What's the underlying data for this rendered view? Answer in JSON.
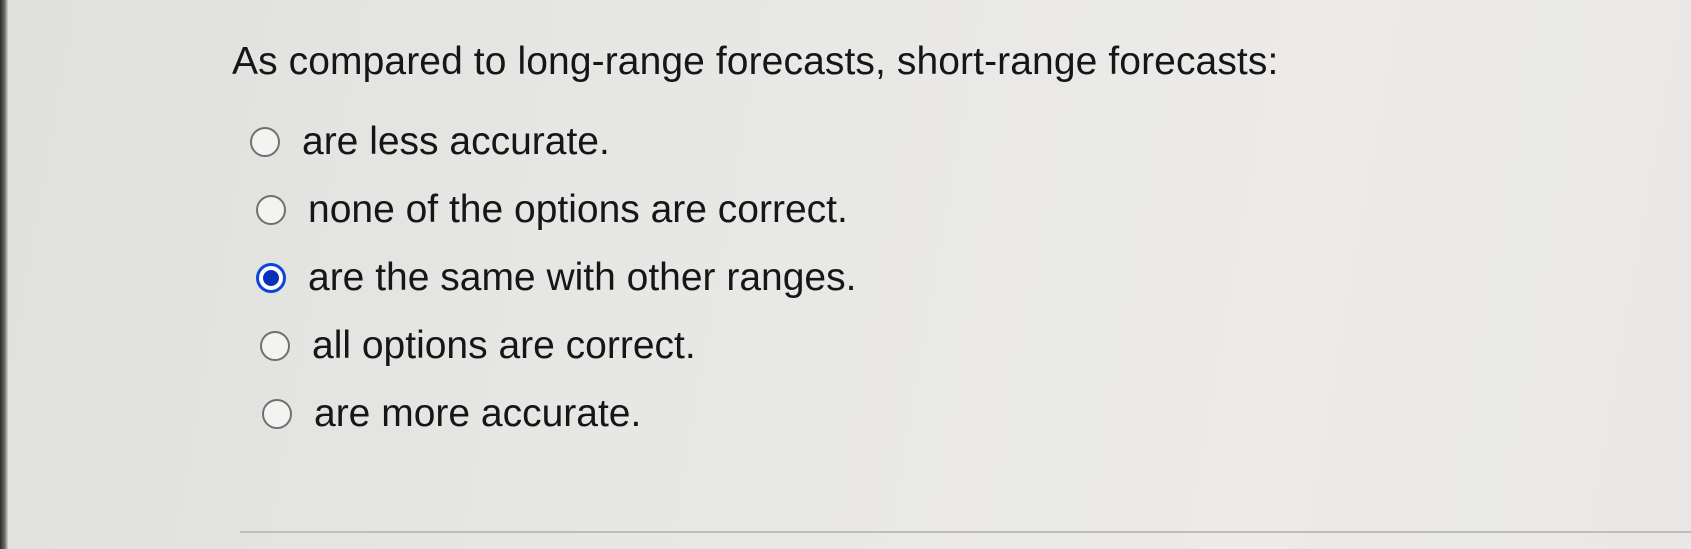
{
  "question": {
    "text": "As compared to long-range forecasts, short-range forecasts:"
  },
  "options": [
    {
      "label": "are less accurate.",
      "selected": false
    },
    {
      "label": "none of the options are correct.",
      "selected": false
    },
    {
      "label": "are the same with other ranges.",
      "selected": true
    },
    {
      "label": "all options are correct.",
      "selected": false
    },
    {
      "label": "are more accurate.",
      "selected": false
    }
  ],
  "colors": {
    "selected_radio": "#0a47d8",
    "text": "#161616"
  }
}
